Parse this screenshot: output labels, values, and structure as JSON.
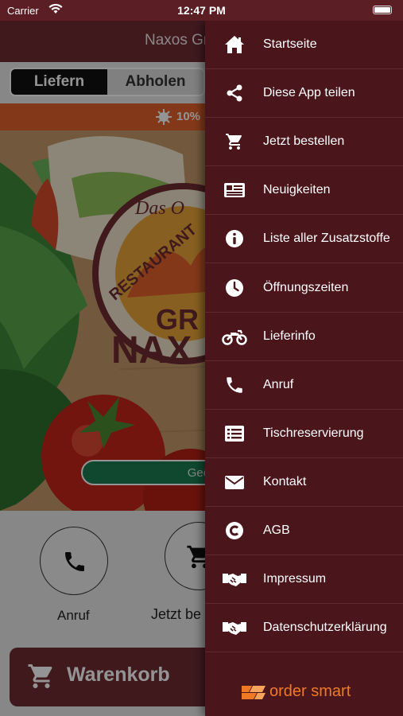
{
  "status_bar": {
    "carrier": "Carrier",
    "time": "12:47 PM"
  },
  "app": {
    "title": "Naxos Gr",
    "segments": {
      "delivery": "Liefern",
      "pickup": "Abholen"
    },
    "promo": "10%",
    "hero": {
      "top_script": "Das O",
      "arch_text": "RESTAURANT",
      "name_top": "GR",
      "name_bottom": "NAX"
    },
    "open_status": "Geöf",
    "actions": {
      "call": "Anruf",
      "order": "Jetzt be"
    },
    "cart": "Warenkorb"
  },
  "drawer": {
    "items": [
      {
        "label": "Startseite",
        "icon": "home-icon"
      },
      {
        "label": "Diese App teilen",
        "icon": "share-icon"
      },
      {
        "label": "Jetzt bestellen",
        "icon": "cart-icon"
      },
      {
        "label": "Neuigkeiten",
        "icon": "newspaper-icon"
      },
      {
        "label": "Liste aller Zusatzstoffe",
        "icon": "info-icon"
      },
      {
        "label": "Öffnungszeiten",
        "icon": "clock-icon"
      },
      {
        "label": "Lieferinfo",
        "icon": "motorcycle-icon"
      },
      {
        "label": "Anruf",
        "icon": "phone-icon"
      },
      {
        "label": "Tischreservierung",
        "icon": "list-icon"
      },
      {
        "label": "Kontakt",
        "icon": "envelope-icon"
      },
      {
        "label": "AGB",
        "icon": "copyright-icon"
      },
      {
        "label": "Impressum",
        "icon": "handshake-icon"
      },
      {
        "label": "Datenschutzerklärung",
        "icon": "handshake-icon"
      }
    ],
    "brand": "order smart"
  },
  "colors": {
    "header": "#6e2c33",
    "drawer": "#4a161b",
    "promo": "#e2622b",
    "open": "#1a7a52",
    "brand": "#f07a24"
  }
}
